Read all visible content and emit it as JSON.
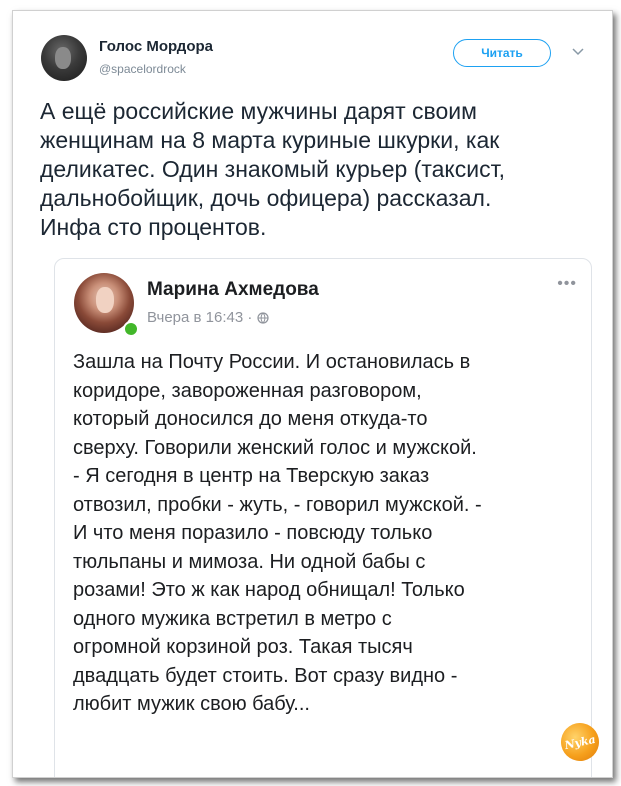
{
  "tweet": {
    "author_name": "Голос Мордора",
    "author_handle": "@spacelordrock",
    "follow_label": "Читать",
    "text": "А ещё российские мужчины дарят своим\nженщинам на 8 марта куриные шкурки, как\nделикатес. Один знакомый курьер (таксист,\nдальнобойщик, дочь офицера) рассказал.\nИнфа сто процентов."
  },
  "quote": {
    "author_name": "Марина Ахмедова",
    "timestamp": "Вчера в 16:43 ·",
    "more_label": "•••",
    "text": "Зашла на Почту России. И остановилась в\nкоридоре, завороженная разговором,\nкоторый доносился до меня  откуда-то\nсверху. Говорили женский голос и мужской.\n- Я сегодня в центр на Тверскую заказ\nотвозил, пробки - жуть, - говорил мужской. -\nИ что меня поразило - повсюду только\nтюльпаны и мимоза. Ни одной бабы с\nрозами! Это ж как народ обнищал! Только\nодного мужика встретил в метро с\nогромной корзиной роз. Такая тысяч\nдвадцать будет стоить. Вот сразу видно -\nлюбит мужик свою бабу..."
  },
  "watermark": {
    "text": "Nyka"
  },
  "colors": {
    "accent": "#1da1f2",
    "online": "#42b72a",
    "watermark": "#f6a01c"
  }
}
